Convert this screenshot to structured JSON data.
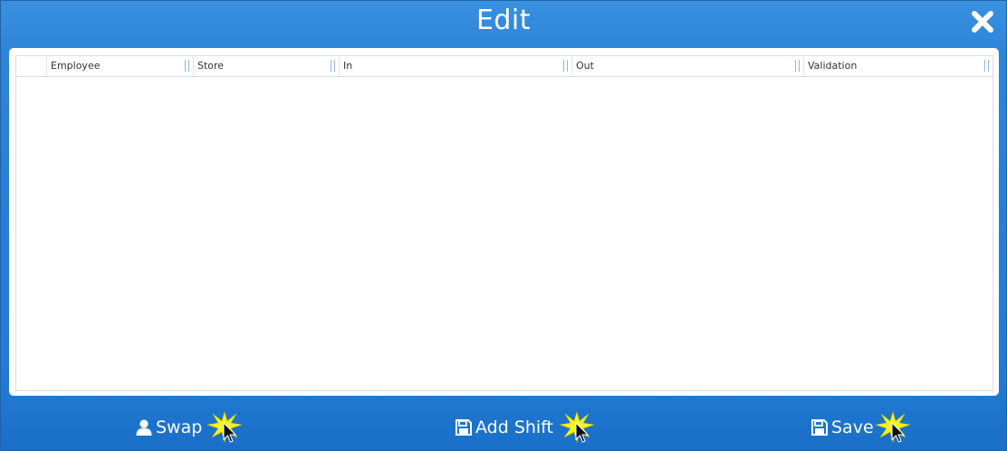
{
  "dialog": {
    "title": "Edit",
    "close_icon": "close-icon"
  },
  "grid": {
    "columns": [
      {
        "label": ""
      },
      {
        "label": "Employee"
      },
      {
        "label": "Store"
      },
      {
        "label": "In"
      },
      {
        "label": "Out"
      },
      {
        "label": "Validation"
      }
    ],
    "rows": []
  },
  "footer": {
    "swap_label": "Swap",
    "swap_icon": "user-icon",
    "add_shift_label": "Add Shift",
    "add_shift_icon": "save-icon",
    "save_label": "Save",
    "save_icon": "save-icon"
  },
  "colors": {
    "accent": "#2d84d8",
    "panel": "#ffffff",
    "spark": "#f3f21e"
  }
}
